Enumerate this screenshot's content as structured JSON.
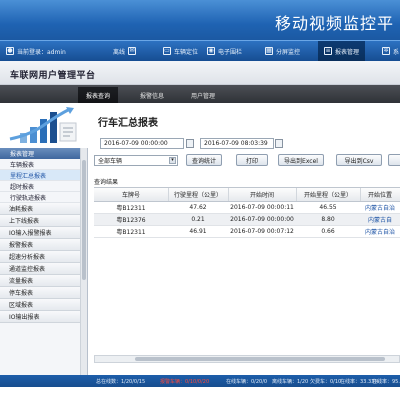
{
  "header": {
    "banner_title": "移动视频监控平"
  },
  "topnav": {
    "user": "当前登录：admin",
    "items": [
      {
        "label": "离线",
        "icon": "envelope-icon"
      },
      {
        "label": "车辆定位",
        "icon": "car-icon"
      },
      {
        "label": "电子围栏",
        "icon": "location-pin-icon"
      },
      {
        "label": "分屏监控",
        "icon": "grid-icon"
      },
      {
        "label": "报表管理",
        "icon": "report-icon"
      },
      {
        "label": "系",
        "icon": "gear-icon"
      }
    ]
  },
  "product": {
    "title": "车联网用户管理平台"
  },
  "tabs": [
    {
      "label": "报表查询"
    },
    {
      "label": "报警信息"
    },
    {
      "label": "用户管理"
    }
  ],
  "sidebar": {
    "section_title": "报表管理",
    "items": [
      {
        "label": "车辆报表"
      },
      {
        "label": "里程汇总报表"
      },
      {
        "label": "超时报表"
      },
      {
        "label": "行驶轨迹报表"
      }
    ],
    "groups": [
      {
        "label": "油耗报表"
      },
      {
        "label": "上下线报表"
      },
      {
        "label": "IO输入报警报表"
      },
      {
        "label": "报警报表"
      },
      {
        "label": "超速分析报表"
      },
      {
        "label": "通道监控报表"
      },
      {
        "label": "流量报表"
      },
      {
        "label": "停车报表"
      },
      {
        "label": "区域报表"
      },
      {
        "label": "IO输出报表"
      }
    ]
  },
  "main": {
    "page_title": "行车汇总报表",
    "start_time": "2016-07-09 00:00:00",
    "end_time": "2016-07-09 08:03:39",
    "vehicle_select": "全部车辆",
    "buttons": {
      "query": "查询统计",
      "print": "打印",
      "export_excel": "导出到Excel",
      "export_csv": "导出到Csv"
    },
    "results_label": "查询结果",
    "columns": [
      "车牌号",
      "行驶里程（公里）",
      "开始时间",
      "开始里程（公里）",
      "开始位置"
    ],
    "rows": [
      [
        "粤B12311",
        "47.62",
        "2016-07-09 00:00:11",
        "46.55",
        "内蒙古自治"
      ],
      [
        "粤B12376",
        "0.21",
        "2016-07-09 00:00:00",
        "8.80",
        "内蒙古自"
      ],
      [
        "粤B12311",
        "46.91",
        "2016-07-09 00:07:12",
        "0.66",
        "内蒙古自治"
      ]
    ]
  },
  "statusbar": {
    "segments": [
      {
        "label": "总在线数：1/20/0/15",
        "warn": false
      },
      {
        "label": "报警车辆：0/10/0/20",
        "warn": true
      },
      {
        "label": "在线车辆：0/20/0",
        "warn": false
      },
      {
        "label": "离线车辆：1/20",
        "warn": false
      },
      {
        "label": "欠费车：0/10",
        "warn": false
      },
      {
        "label": "在线率：33.33%",
        "warn": false
      },
      {
        "label": "在线率：95.00%",
        "warn": false
      }
    ]
  }
}
